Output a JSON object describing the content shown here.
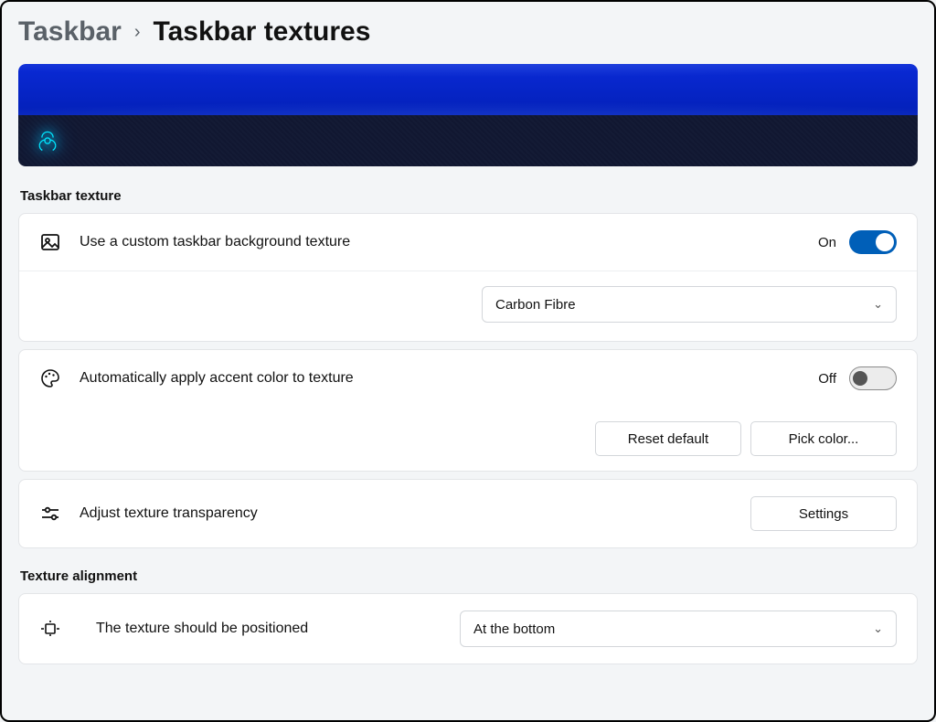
{
  "breadcrumb": {
    "parent": "Taskbar",
    "current": "Taskbar textures"
  },
  "sections": {
    "texture_title": "Taskbar texture",
    "alignment_title": "Texture alignment"
  },
  "texture": {
    "custom_bg_label": "Use a custom taskbar background texture",
    "custom_bg_state": "On",
    "texture_selected": "Carbon Fibre",
    "accent_label": "Automatically apply accent color to texture",
    "accent_state": "Off",
    "reset_btn": "Reset default",
    "pick_btn": "Pick color...",
    "transparency_label": "Adjust texture transparency",
    "settings_btn": "Settings"
  },
  "alignment": {
    "position_label": "The texture should be positioned",
    "position_selected": "At the bottom"
  }
}
